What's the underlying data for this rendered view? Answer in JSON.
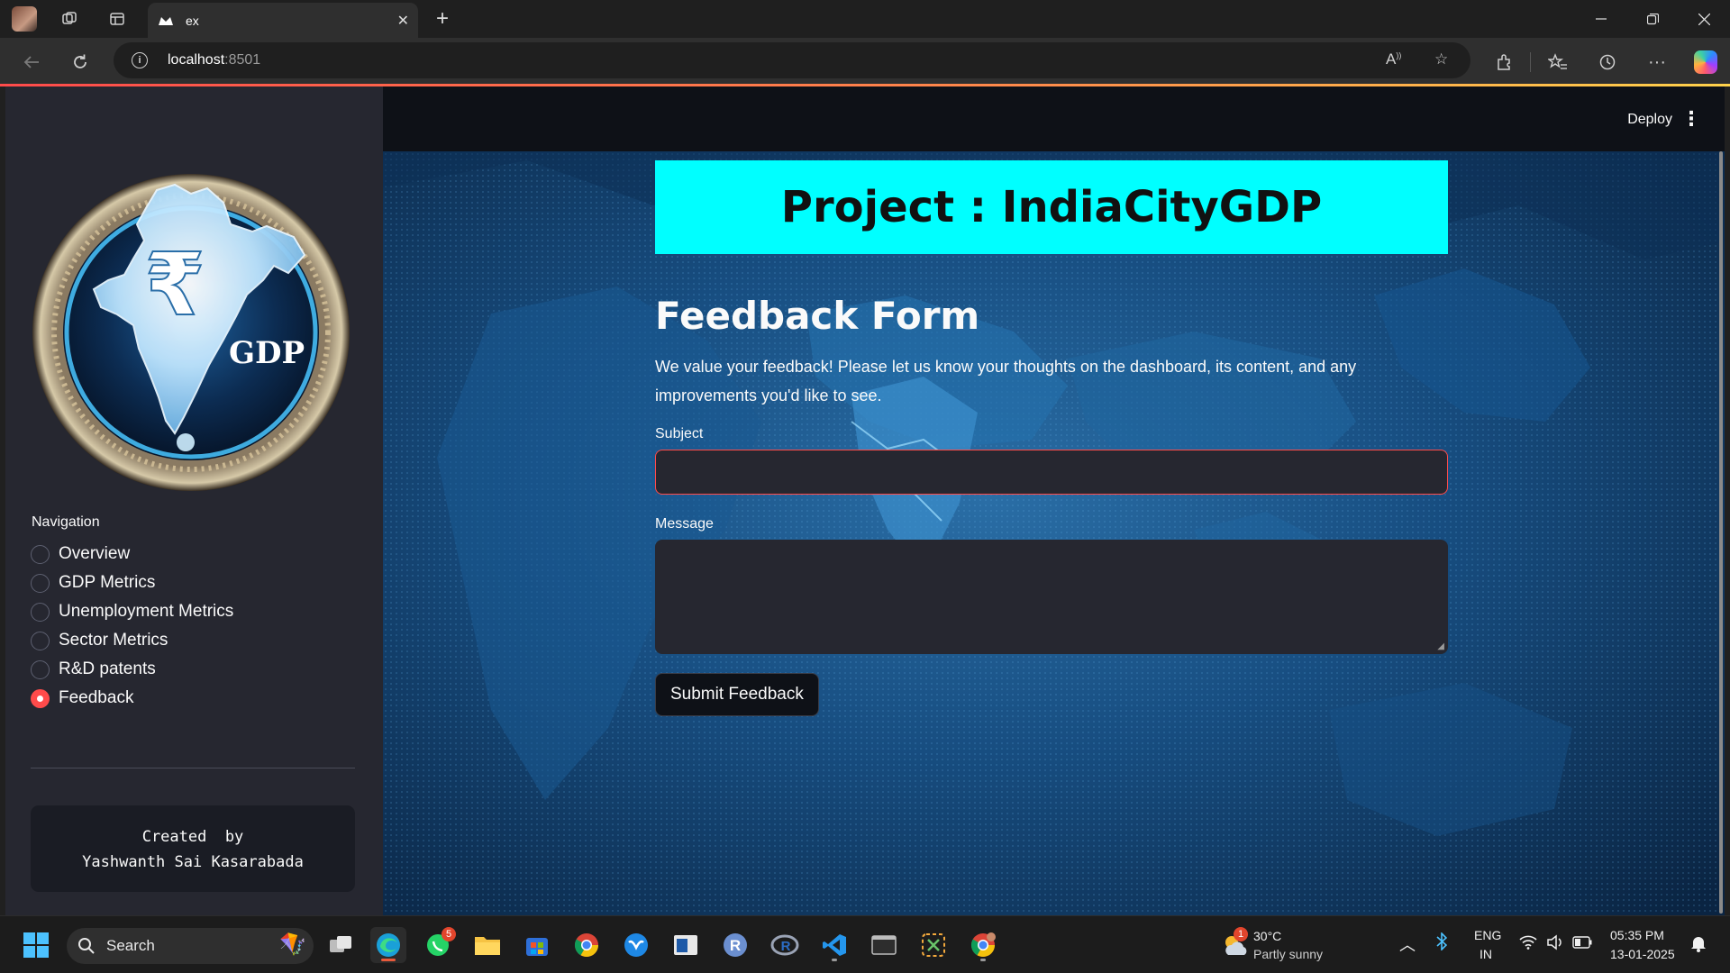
{
  "browser": {
    "tab_title": "ex",
    "url_host": "localhost",
    "url_port": ":8501",
    "new_tab_symbol": "+"
  },
  "app": {
    "deploy_label": "Deploy",
    "sidebar": {
      "logo_text": "GDP",
      "navigation_label": "Navigation",
      "nav_items": [
        {
          "label": "Overview",
          "selected": false
        },
        {
          "label": "GDP Metrics",
          "selected": false
        },
        {
          "label": "Unemployment Metrics",
          "selected": false
        },
        {
          "label": "Sector Metrics",
          "selected": false
        },
        {
          "label": "R&D patents",
          "selected": false
        },
        {
          "label": "Feedback",
          "selected": true
        }
      ],
      "credit_line1": "Created  by",
      "credit_line2": "Yashwanth Sai Kasarabada"
    },
    "main": {
      "project_title": "Project : IndiaCityGDP",
      "form_title": "Feedback Form",
      "form_description": "We value your feedback! Please let us know your thoughts on the dashboard, its content, and any improvements you'd like to see.",
      "subject_label": "Subject",
      "subject_value": "",
      "message_label": "Message",
      "message_value": "",
      "submit_label": "Submit Feedback"
    },
    "colors": {
      "accent": "#ff4b4b",
      "banner": "#00ffff",
      "sidebar_bg": "#262730",
      "main_bg": "#0e1117"
    }
  },
  "taskbar": {
    "search_label": "Search",
    "whatsapp_badge": "5",
    "weather_badge": "1",
    "temperature": "30°C",
    "weather": "Partly sunny",
    "language": "ENG",
    "region": "IN",
    "time": "05:35 PM",
    "date": "13-01-2025"
  }
}
